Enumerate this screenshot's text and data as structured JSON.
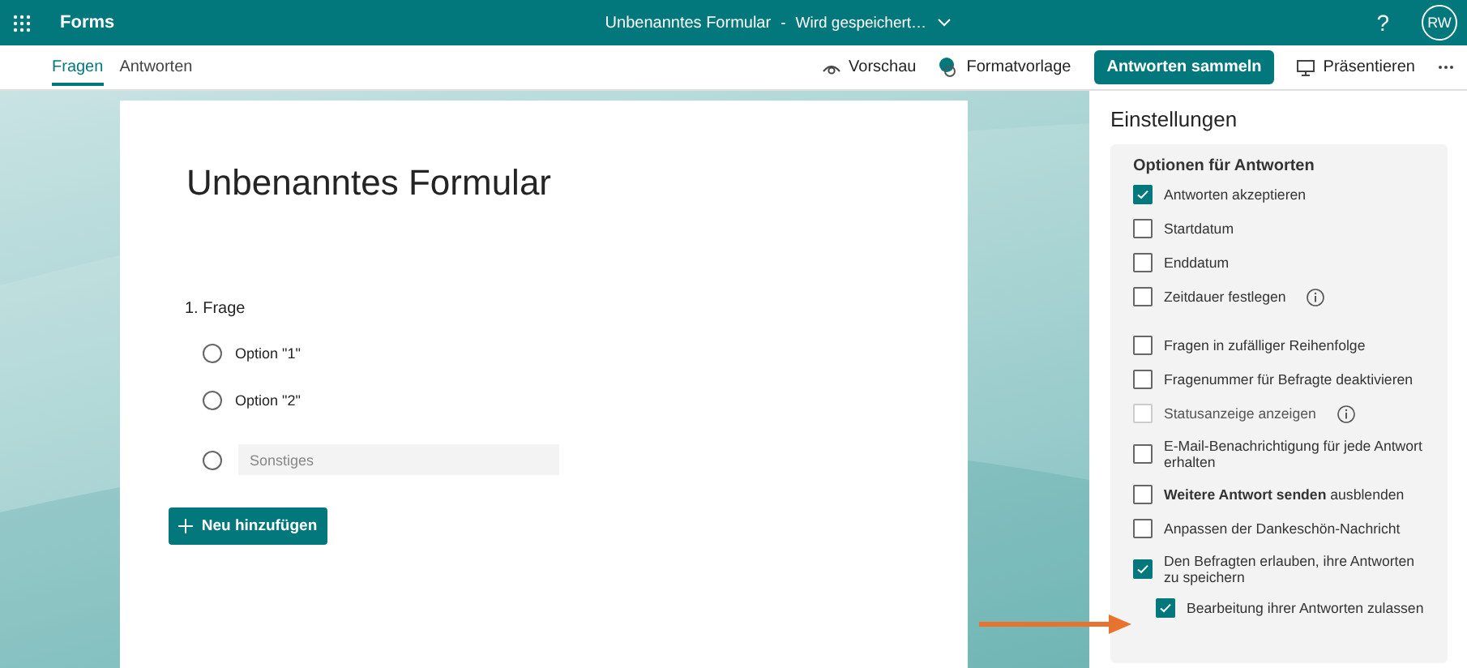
{
  "app_bar": {
    "app_name": "Forms",
    "form_title": "Unbenanntes Formular",
    "separator": "-",
    "save_status": "Wird gespeichert…",
    "help": "?",
    "avatar": "RW"
  },
  "tabs": [
    {
      "label": "Fragen",
      "selected": true
    },
    {
      "label": "Antworten",
      "selected": false
    }
  ],
  "toolbar": {
    "preview": "Vorschau",
    "style": "Formatvorlage",
    "collect": "Antworten sammeln",
    "present": "Präsentieren"
  },
  "form": {
    "title": "Unbenanntes Formular",
    "question": "1. Frage",
    "options": [
      {
        "label": "Option \"1\"",
        "selected": false
      },
      {
        "label": "Option \"2\"",
        "selected": false
      }
    ],
    "other": {
      "placeholder": "Sonstiges",
      "selected": false
    },
    "add_button": "Neu hinzufügen"
  },
  "settings": {
    "title": "Einstellungen",
    "section": "Optionen für Antworten",
    "groups": [
      {
        "items": [
          {
            "label": "Antworten akzeptieren",
            "checked": true,
            "disabled": false,
            "info": false
          },
          {
            "label": "Startdatum",
            "checked": false,
            "disabled": false,
            "info": false
          },
          {
            "label": "Enddatum",
            "checked": false,
            "disabled": false,
            "info": false
          },
          {
            "label": "Zeitdauer festlegen",
            "checked": false,
            "disabled": false,
            "info": true
          }
        ]
      },
      {
        "items": [
          {
            "label": "Fragen in zufälliger Reihenfolge",
            "checked": false,
            "disabled": false,
            "info": false
          },
          {
            "label": "Fragenummer für Befragte deaktivieren",
            "checked": false,
            "disabled": false,
            "info": false
          },
          {
            "label": "Statusanzeige anzeigen",
            "checked": false,
            "disabled": true,
            "info": true
          },
          {
            "label": "E-Mail-Benachrichtigung für jede Antwort erhalten",
            "checked": false,
            "disabled": false,
            "info": false
          },
          {
            "label": "**Weitere Antwort senden** ausblenden",
            "checked": false,
            "disabled": false,
            "info": false
          },
          {
            "label": "Anpassen der Dankeschön-Nachricht",
            "checked": false,
            "disabled": false,
            "info": false
          },
          {
            "label": "Den Befragten erlauben, ihre Antworten zu speichern",
            "checked": true,
            "disabled": false,
            "info": false,
            "children": [
              {
                "label": "Bearbeitung ihrer Antworten zulassen",
                "checked": true,
                "disabled": false,
                "info": false
              }
            ]
          }
        ]
      }
    ]
  }
}
